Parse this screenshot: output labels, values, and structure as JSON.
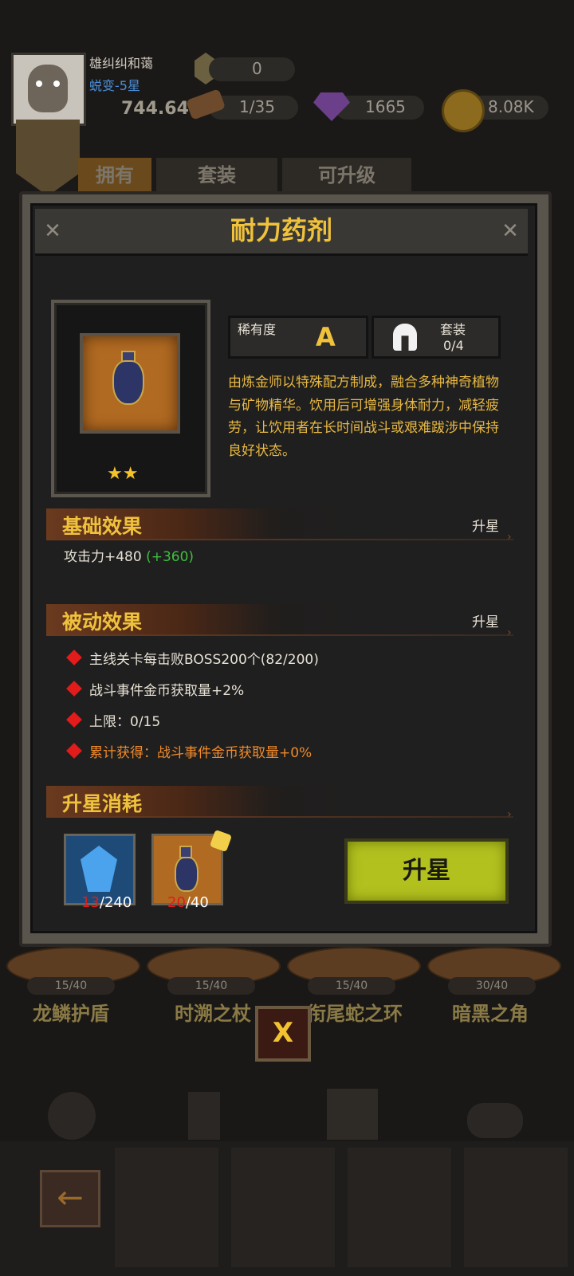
{
  "player": {
    "name": "雄纠纠和蔼",
    "rank": "蜕变-5星",
    "power": "744.64K"
  },
  "currencies": {
    "hex_gem": "0",
    "forge": "1/35",
    "diamond": "1665",
    "gold": "8.08K"
  },
  "background_tabs": [
    "拥有",
    "套装",
    "可升级"
  ],
  "modal": {
    "title": "耐力药剂",
    "item_icon": "potion-vase-icon",
    "stars": 2,
    "stars_text": "★★",
    "rarity_label": "稀有度",
    "rarity_value": "A",
    "set_label": "套装",
    "set_value": "0/4",
    "description": "由炼金师以特殊配方制成，融合多种神奇植物与矿物精华。饮用后可增强身体耐力，减轻疲劳，让饮用者在长时间战斗或艰难跋涉中保持良好状态。",
    "basic_section": {
      "title": "基础效果",
      "link": "升星",
      "effect": "攻击力+480",
      "bonus": "(+360)"
    },
    "passive_section": {
      "title": "被动效果",
      "link": "升星",
      "items": [
        "主线关卡每击败BOSS200个(82/200)",
        "战斗事件金币获取量+2%",
        "上限：0/15",
        "累计获得：战斗事件金币获取量+0%"
      ]
    },
    "cost_section": {
      "title": "升星消耗",
      "costs": [
        {
          "icon": "blue-crystal-icon",
          "have": "13",
          "need": "/240"
        },
        {
          "icon": "potion-vase-icon",
          "have": "20",
          "need": "/40"
        }
      ],
      "button": "升星"
    }
  },
  "pedestals": [
    {
      "progress": "15/40",
      "name": "龙鳞护盾"
    },
    {
      "progress": "15/40",
      "name": "时溯之杖"
    },
    {
      "progress": "15/40",
      "name": "衔尾蛇之环"
    },
    {
      "progress": "30/40",
      "name": "暗黑之角"
    }
  ],
  "close_label": "X",
  "back_label": "←",
  "colors": {
    "title_gold": "#f0c23c",
    "desc_gold": "#e8b842",
    "bonus_green": "#3fbf3f",
    "danger_red": "#e21b1b",
    "button_lime": "#b3c11f"
  }
}
